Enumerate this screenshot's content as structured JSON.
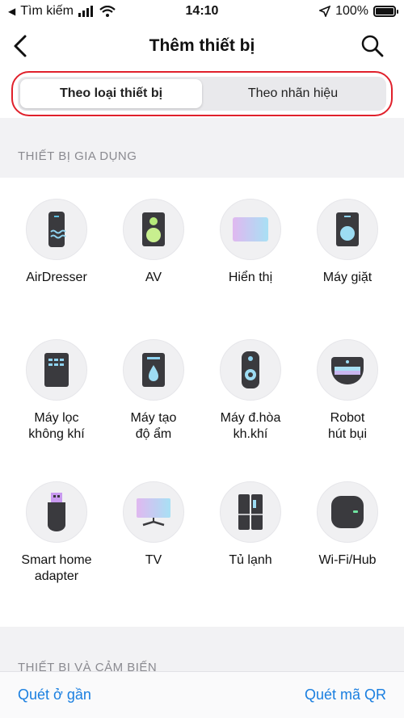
{
  "status_bar": {
    "carrier": "Tìm kiếm",
    "time": "14:10",
    "battery": "100%"
  },
  "nav": {
    "title": "Thêm thiết bị"
  },
  "tabs": [
    {
      "label": "Theo loại thiết bị",
      "active": true
    },
    {
      "label": "Theo nhãn hiệu",
      "active": false
    }
  ],
  "sections": {
    "home_appliances": "THIẾT BỊ GIA DỤNG",
    "devices_sensors": "THIẾT BỊ VÀ CẢM BIẾN"
  },
  "devices": [
    {
      "label": "AirDresser",
      "icon": "airdresser-icon"
    },
    {
      "label": "AV",
      "icon": "speaker-icon"
    },
    {
      "label": "Hiển thị",
      "icon": "display-icon"
    },
    {
      "label": "Máy giặt",
      "icon": "washer-icon"
    },
    {
      "label": "Máy lọc\nkhông khí",
      "icon": "air-purifier-icon"
    },
    {
      "label": "Máy tạo\nđộ ẩm",
      "icon": "humidifier-icon"
    },
    {
      "label": "Máy đ.hòa\nkh.khí",
      "icon": "air-conditioner-remote-icon"
    },
    {
      "label": "Robot\nhút bụi",
      "icon": "robot-vacuum-icon"
    },
    {
      "label": "Smart home\nadapter",
      "icon": "usb-adapter-icon"
    },
    {
      "label": "TV",
      "icon": "tv-icon"
    },
    {
      "label": "Tủ lạnh",
      "icon": "refrigerator-icon"
    },
    {
      "label": "Wi-Fi/Hub",
      "icon": "wifi-hub-icon"
    }
  ],
  "bottom": {
    "scan_nearby": "Quét ở gần",
    "scan_qr": "Quét mã QR"
  },
  "colors": {
    "accent_link": "#1a7fe0",
    "highlight_border": "#e0202b",
    "icon_dark": "#3a3a3e"
  }
}
